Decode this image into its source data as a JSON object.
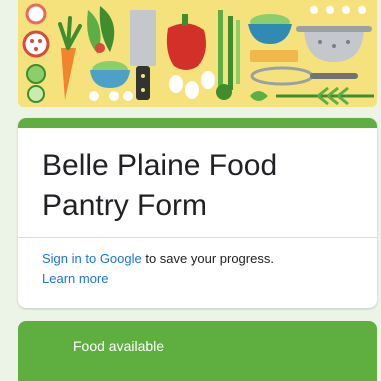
{
  "form": {
    "title": "Belle Plaine Food Pantry Form",
    "signin_link": "Sign in to Google",
    "signin_text": " to save your progress.",
    "learn_more": "Learn more"
  },
  "section": {
    "title": "Food available"
  },
  "colors": {
    "accent": "#5eaf3f",
    "page_background": "#ebf4e6",
    "banner_background": "#f6e27c",
    "link": "#1a73e8"
  }
}
